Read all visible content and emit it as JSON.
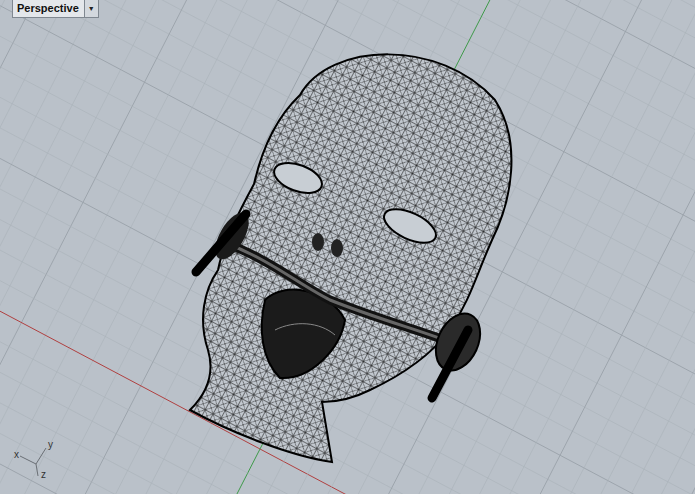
{
  "viewport": {
    "title": "Perspective",
    "menu_glyph": "▼"
  },
  "axis_gizmo": {
    "labels": [
      "x",
      "y",
      "z"
    ]
  }
}
